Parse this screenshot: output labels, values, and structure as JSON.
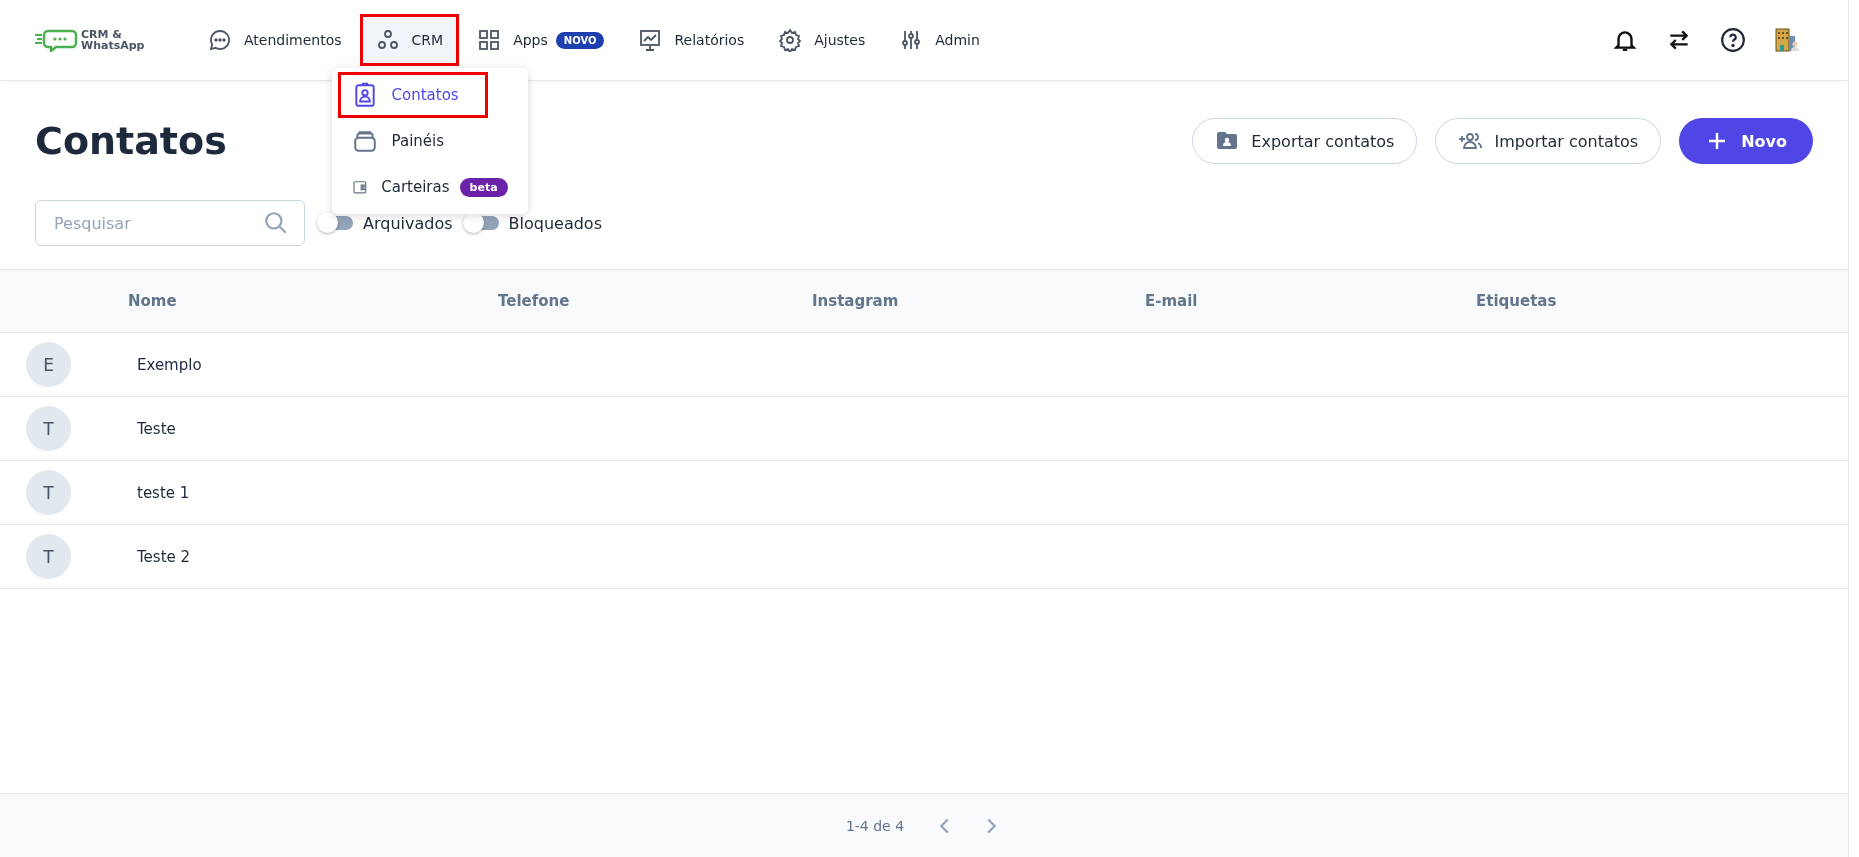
{
  "logo": {
    "text": "CRM &\nWhatsApp"
  },
  "nav": [
    {
      "label": "Atendimentos",
      "selected": false,
      "highlighted": false
    },
    {
      "label": "CRM",
      "selected": true,
      "highlighted": true
    },
    {
      "label": "Apps",
      "badge": "NOVO",
      "selected": false,
      "highlighted": false
    },
    {
      "label": "Relatórios",
      "selected": false,
      "highlighted": false
    },
    {
      "label": "Ajustes",
      "selected": false,
      "highlighted": false
    },
    {
      "label": "Admin",
      "selected": false,
      "highlighted": false
    }
  ],
  "crm_menu": [
    {
      "label": "Contatos",
      "selected": true,
      "highlighted": true
    },
    {
      "label": "Painéis",
      "selected": false,
      "highlighted": false
    },
    {
      "label": "Carteiras",
      "badge": "beta",
      "selected": false,
      "highlighted": false
    }
  ],
  "page_title": "Contatos",
  "actions": [
    {
      "label": "Exportar contatos",
      "kind": "outline"
    },
    {
      "label": "Importar contatos",
      "kind": "outline"
    },
    {
      "label": "Novo",
      "kind": "primary"
    }
  ],
  "search": {
    "placeholder": "Pesquisar"
  },
  "filters": [
    {
      "label": "Arquivados",
      "on": false
    },
    {
      "label": "Bloqueados",
      "on": false
    }
  ],
  "table": {
    "columns": [
      "Nome",
      "Telefone",
      "Instagram",
      "E-mail",
      "Etiquetas"
    ],
    "rows": [
      {
        "initial": "E",
        "name": "Exemplo"
      },
      {
        "initial": "T",
        "name": "Teste"
      },
      {
        "initial": "T",
        "name": "teste 1"
      },
      {
        "initial": "T",
        "name": "Teste 2"
      }
    ]
  },
  "pagination": {
    "range": "1-4 de 4"
  }
}
